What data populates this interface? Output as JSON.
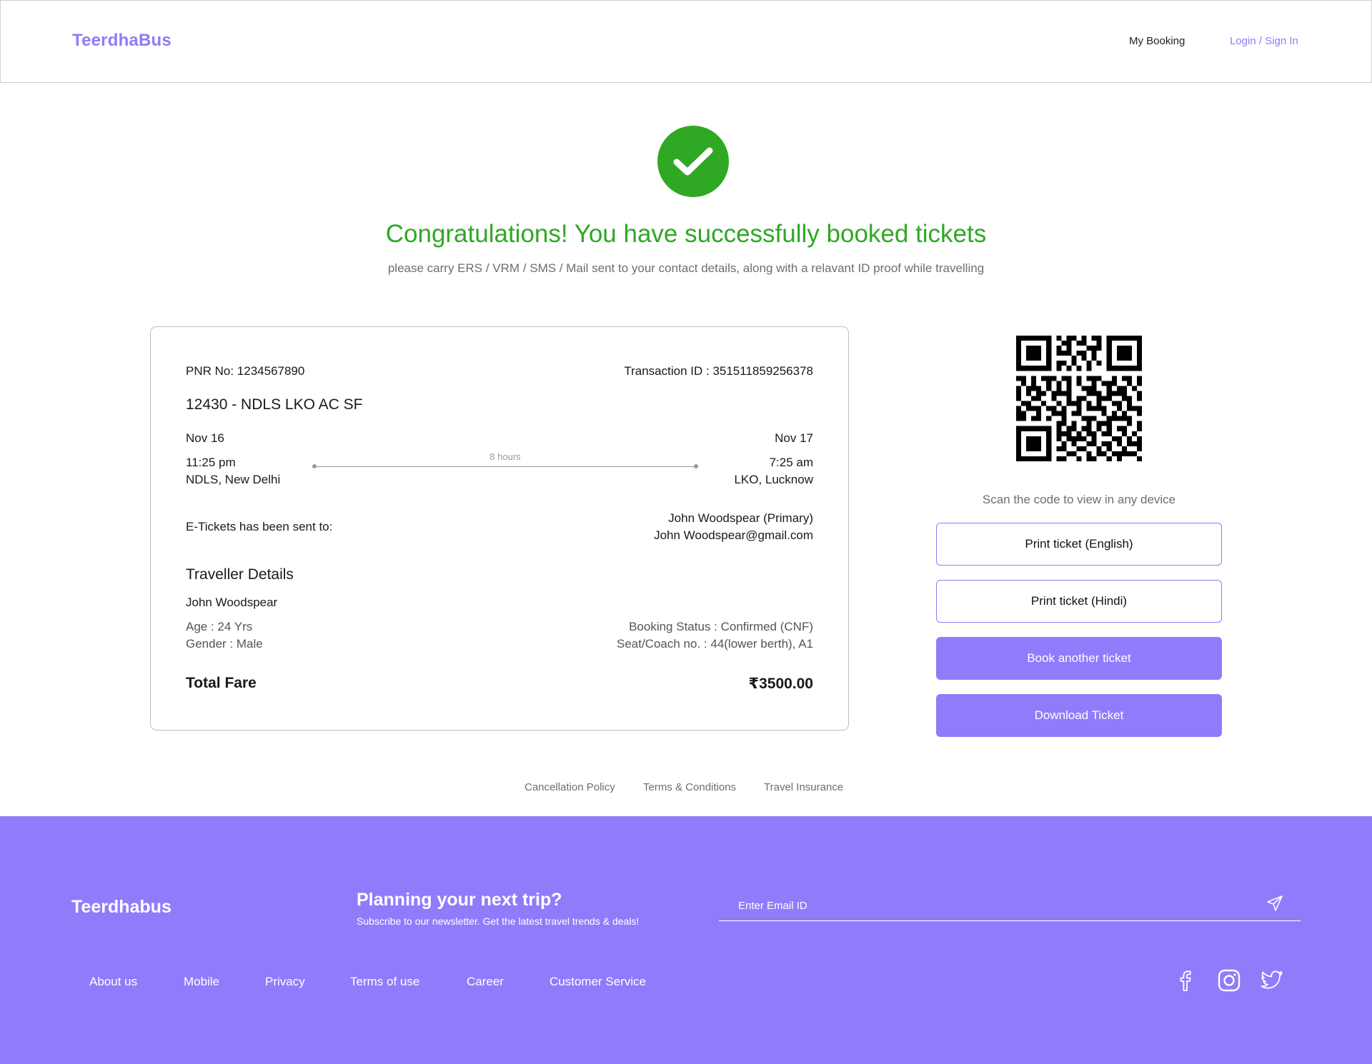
{
  "header": {
    "logo": "TeerdhaBus",
    "my_booking": "My Booking",
    "login": "Login / Sign In"
  },
  "success": {
    "title": "Congratulations! You have successfully booked tickets",
    "subtitle": "please carry ERS / VRM / SMS / Mail sent to your contact details, along with a relavant ID proof while travelling"
  },
  "ticket": {
    "pnr": "PNR No: 1234567890",
    "transaction": "Transaction ID : 351511859256378",
    "route": "12430 - NDLS LKO AC SF",
    "depart_date": "Nov 16",
    "arrive_date": "Nov 17",
    "depart_time": "11:25 pm",
    "arrive_time": "7:25 am",
    "depart_station": "NDLS, New Delhi",
    "arrive_station": "LKO, Lucknow",
    "duration": "8 hours",
    "sent_to_label": "E-Tickets has been sent to:",
    "sent_to_name": "John Woodspear (Primary)",
    "sent_to_email": "John Woodspear@gmail.com",
    "traveller_heading": "Traveller Details",
    "traveller_name": "John Woodspear",
    "age": "Age : 24 Yrs",
    "gender": "Gender : Male",
    "booking_status": "Booking Status : Confirmed (CNF)",
    "seat": "Seat/Coach no. : 44(lower berth), A1",
    "total_label": "Total Fare",
    "total_value": "₹3500.00"
  },
  "side": {
    "scan_text": "Scan the code to view in any device",
    "print_english": "Print ticket (English)",
    "print_hindi": "Print ticket (Hindi)",
    "book_another": "Book another ticket",
    "download": "Download Ticket"
  },
  "policies": {
    "cancellation": "Cancellation Policy",
    "terms": "Terms & Conditions",
    "insurance": "Travel Insurance"
  },
  "footer": {
    "logo": "Teerdhabus",
    "heading": "Planning your next trip?",
    "subheading": "Subscribe to our newsletter. Get the latest travel trends & deals!",
    "email_placeholder": "Enter Email ID",
    "links": [
      "About us",
      "Mobile",
      "Privacy",
      "Terms of use",
      "Career",
      "Customer Service"
    ],
    "social_icons": [
      "facebook-icon",
      "instagram-icon",
      "twitter-icon"
    ]
  },
  "colors": {
    "brand": "#8c7cf8",
    "success": "#2fa824",
    "footer_bg": "#8f7cfb"
  }
}
